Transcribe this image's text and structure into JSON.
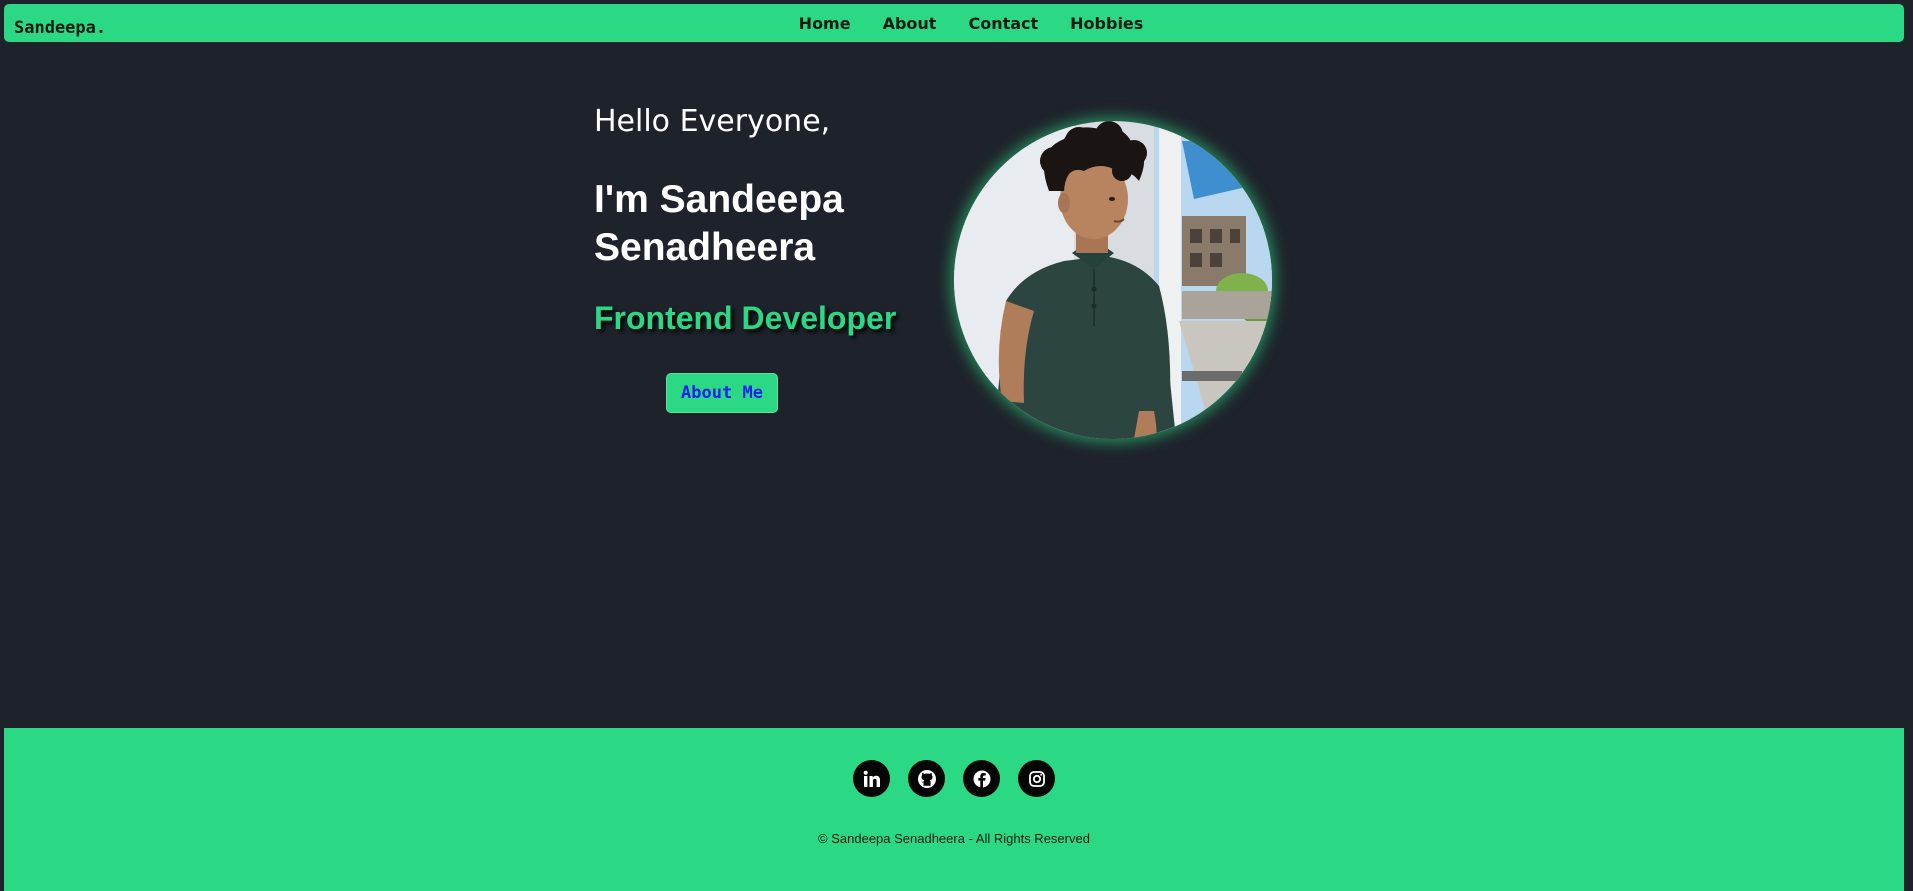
{
  "brand": {
    "name": "Sandeepa."
  },
  "nav": {
    "items": [
      {
        "label": "Home"
      },
      {
        "label": "About"
      },
      {
        "label": "Contact"
      },
      {
        "label": "Hobbies"
      }
    ]
  },
  "hero": {
    "greeting": "Hello Everyone,",
    "name_line1": "I'm Sandeepa",
    "name_line2": "Senadheera",
    "role": "Frontend Developer",
    "button_label": "About Me"
  },
  "portrait": {
    "alt": "profile-photo"
  },
  "footer": {
    "socials": [
      {
        "icon": "linkedin-icon"
      },
      {
        "icon": "github-icon"
      },
      {
        "icon": "facebook-icon"
      },
      {
        "icon": "instagram-icon"
      }
    ],
    "copyright": "© Sandeepa Senadheera - All Rights Reserved"
  },
  "colors": {
    "background": "#1e232b",
    "accent": "#2bd984",
    "button_text": "#1b1ff0"
  }
}
